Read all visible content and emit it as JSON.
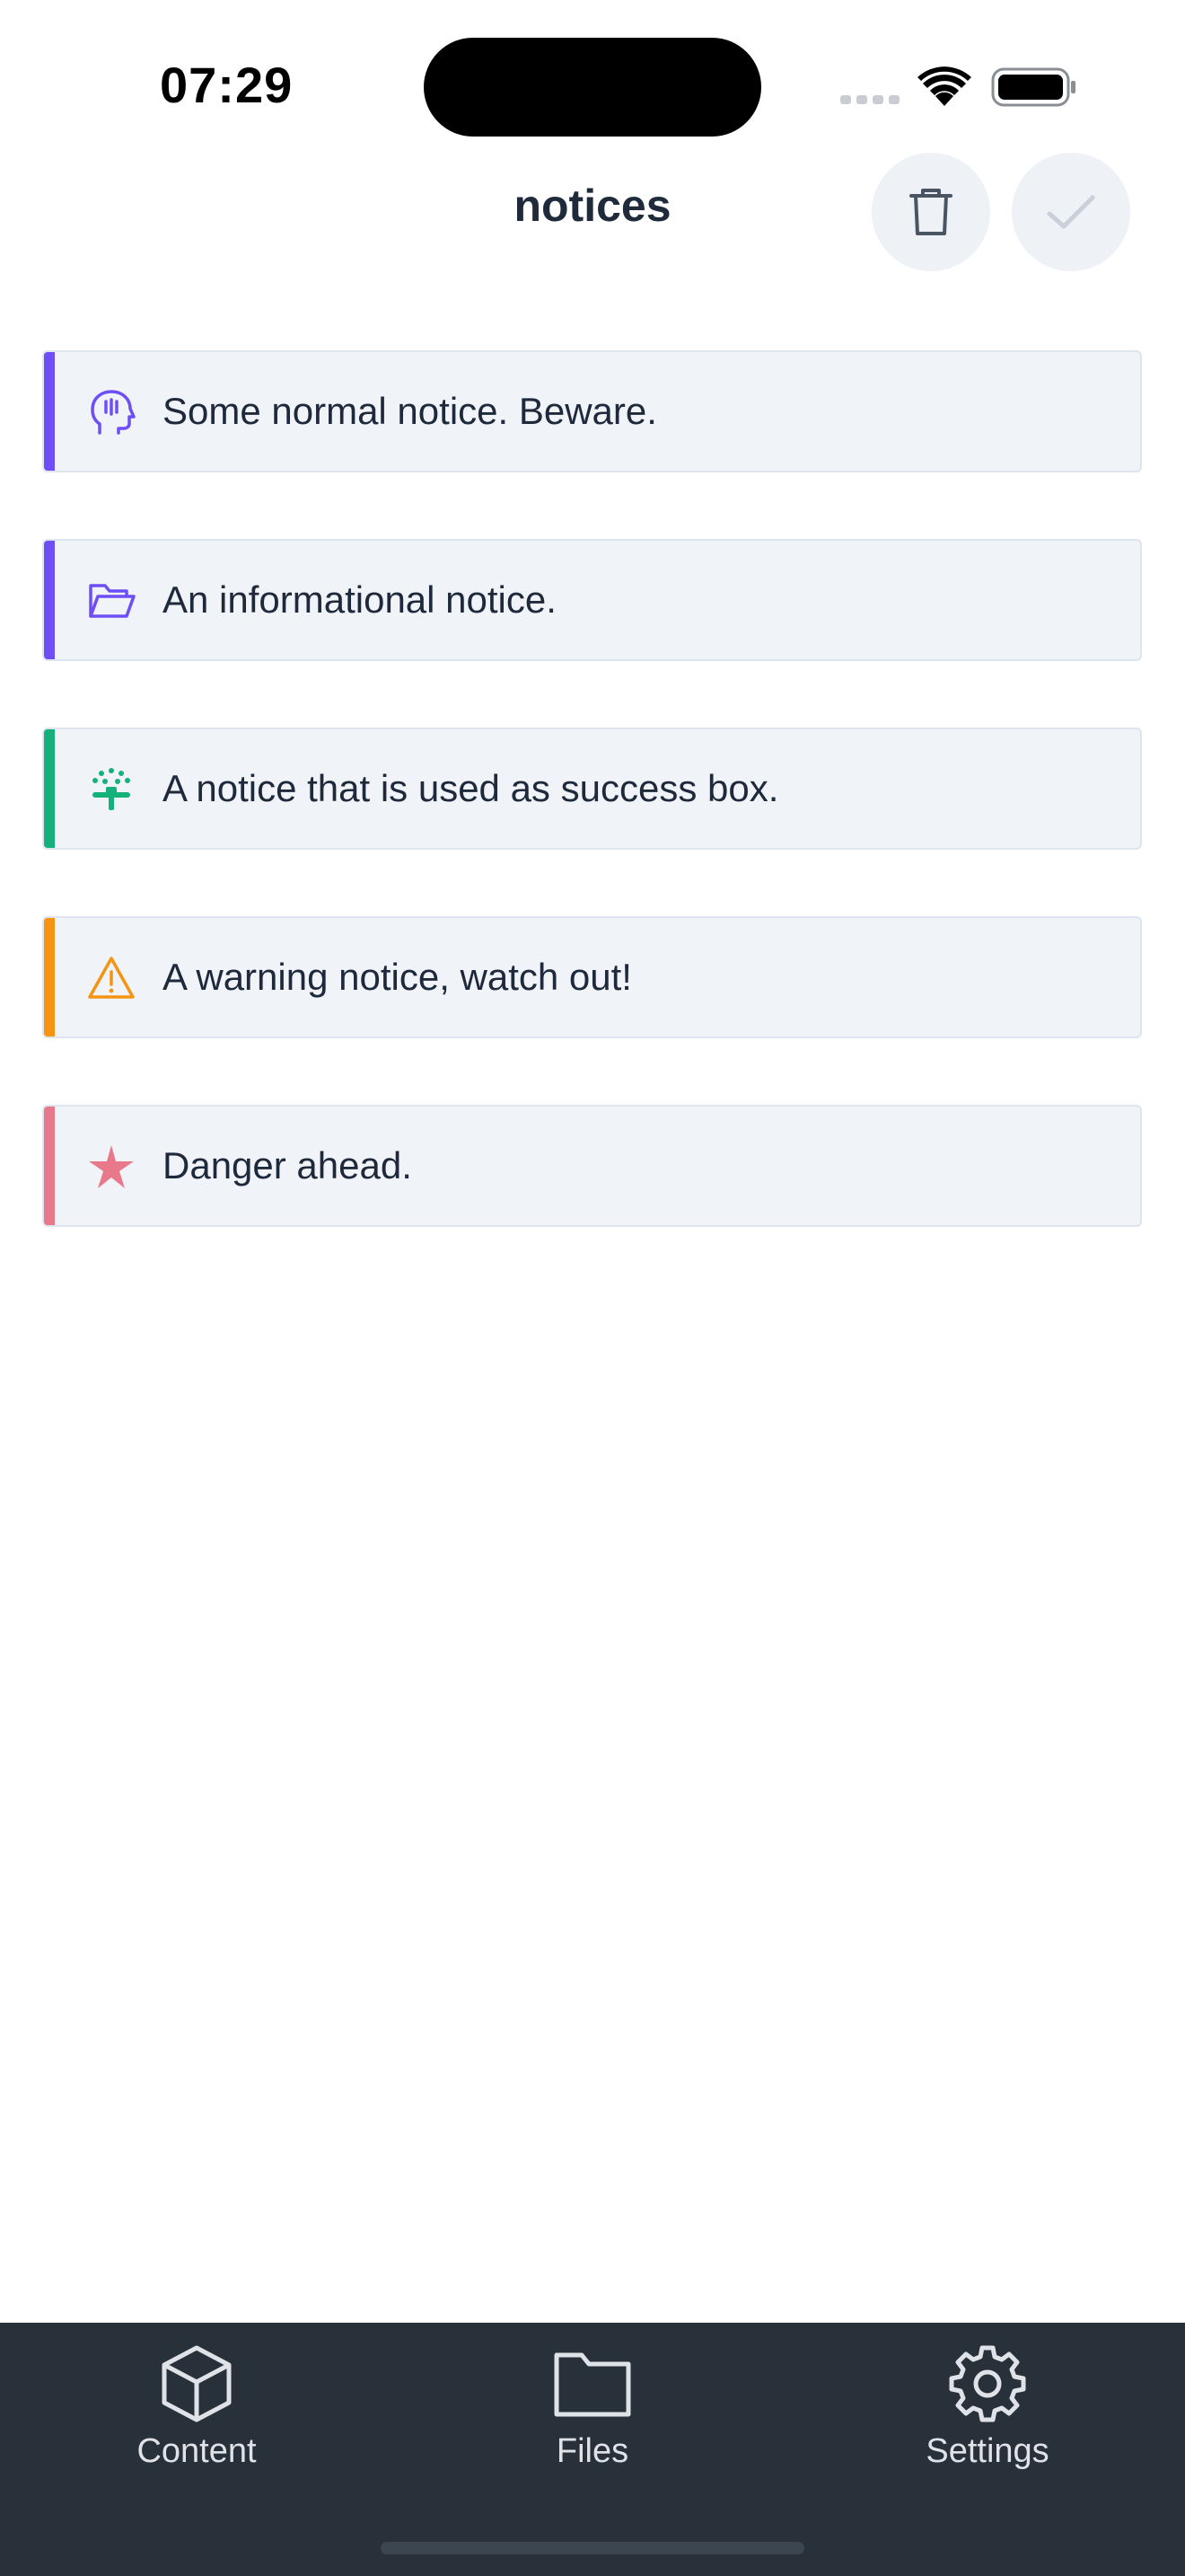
{
  "status_bar": {
    "time": "07:29"
  },
  "header": {
    "title": "notices",
    "delete_icon": "trash-icon",
    "confirm_icon": "check-icon"
  },
  "notices": [
    {
      "text": "Some normal notice. Beware.",
      "icon": "head-icon",
      "color": "#6d4ff5"
    },
    {
      "text": "An informational notice.",
      "icon": "folder-open-icon",
      "color": "#6d4ff5"
    },
    {
      "text": "A notice that is used as success box.",
      "icon": "sprinkler-icon",
      "color": "#14b17a"
    },
    {
      "text": "A warning notice, watch out!",
      "icon": "warning-icon",
      "color": "#f59412"
    },
    {
      "text": "Danger ahead.",
      "icon": "star-icon",
      "color": "#e8798a"
    }
  ],
  "tab_bar": {
    "tabs": [
      {
        "label": "Content",
        "icon": "cube-icon"
      },
      {
        "label": "Files",
        "icon": "folder-icon"
      },
      {
        "label": "Settings",
        "icon": "gear-icon"
      }
    ]
  }
}
